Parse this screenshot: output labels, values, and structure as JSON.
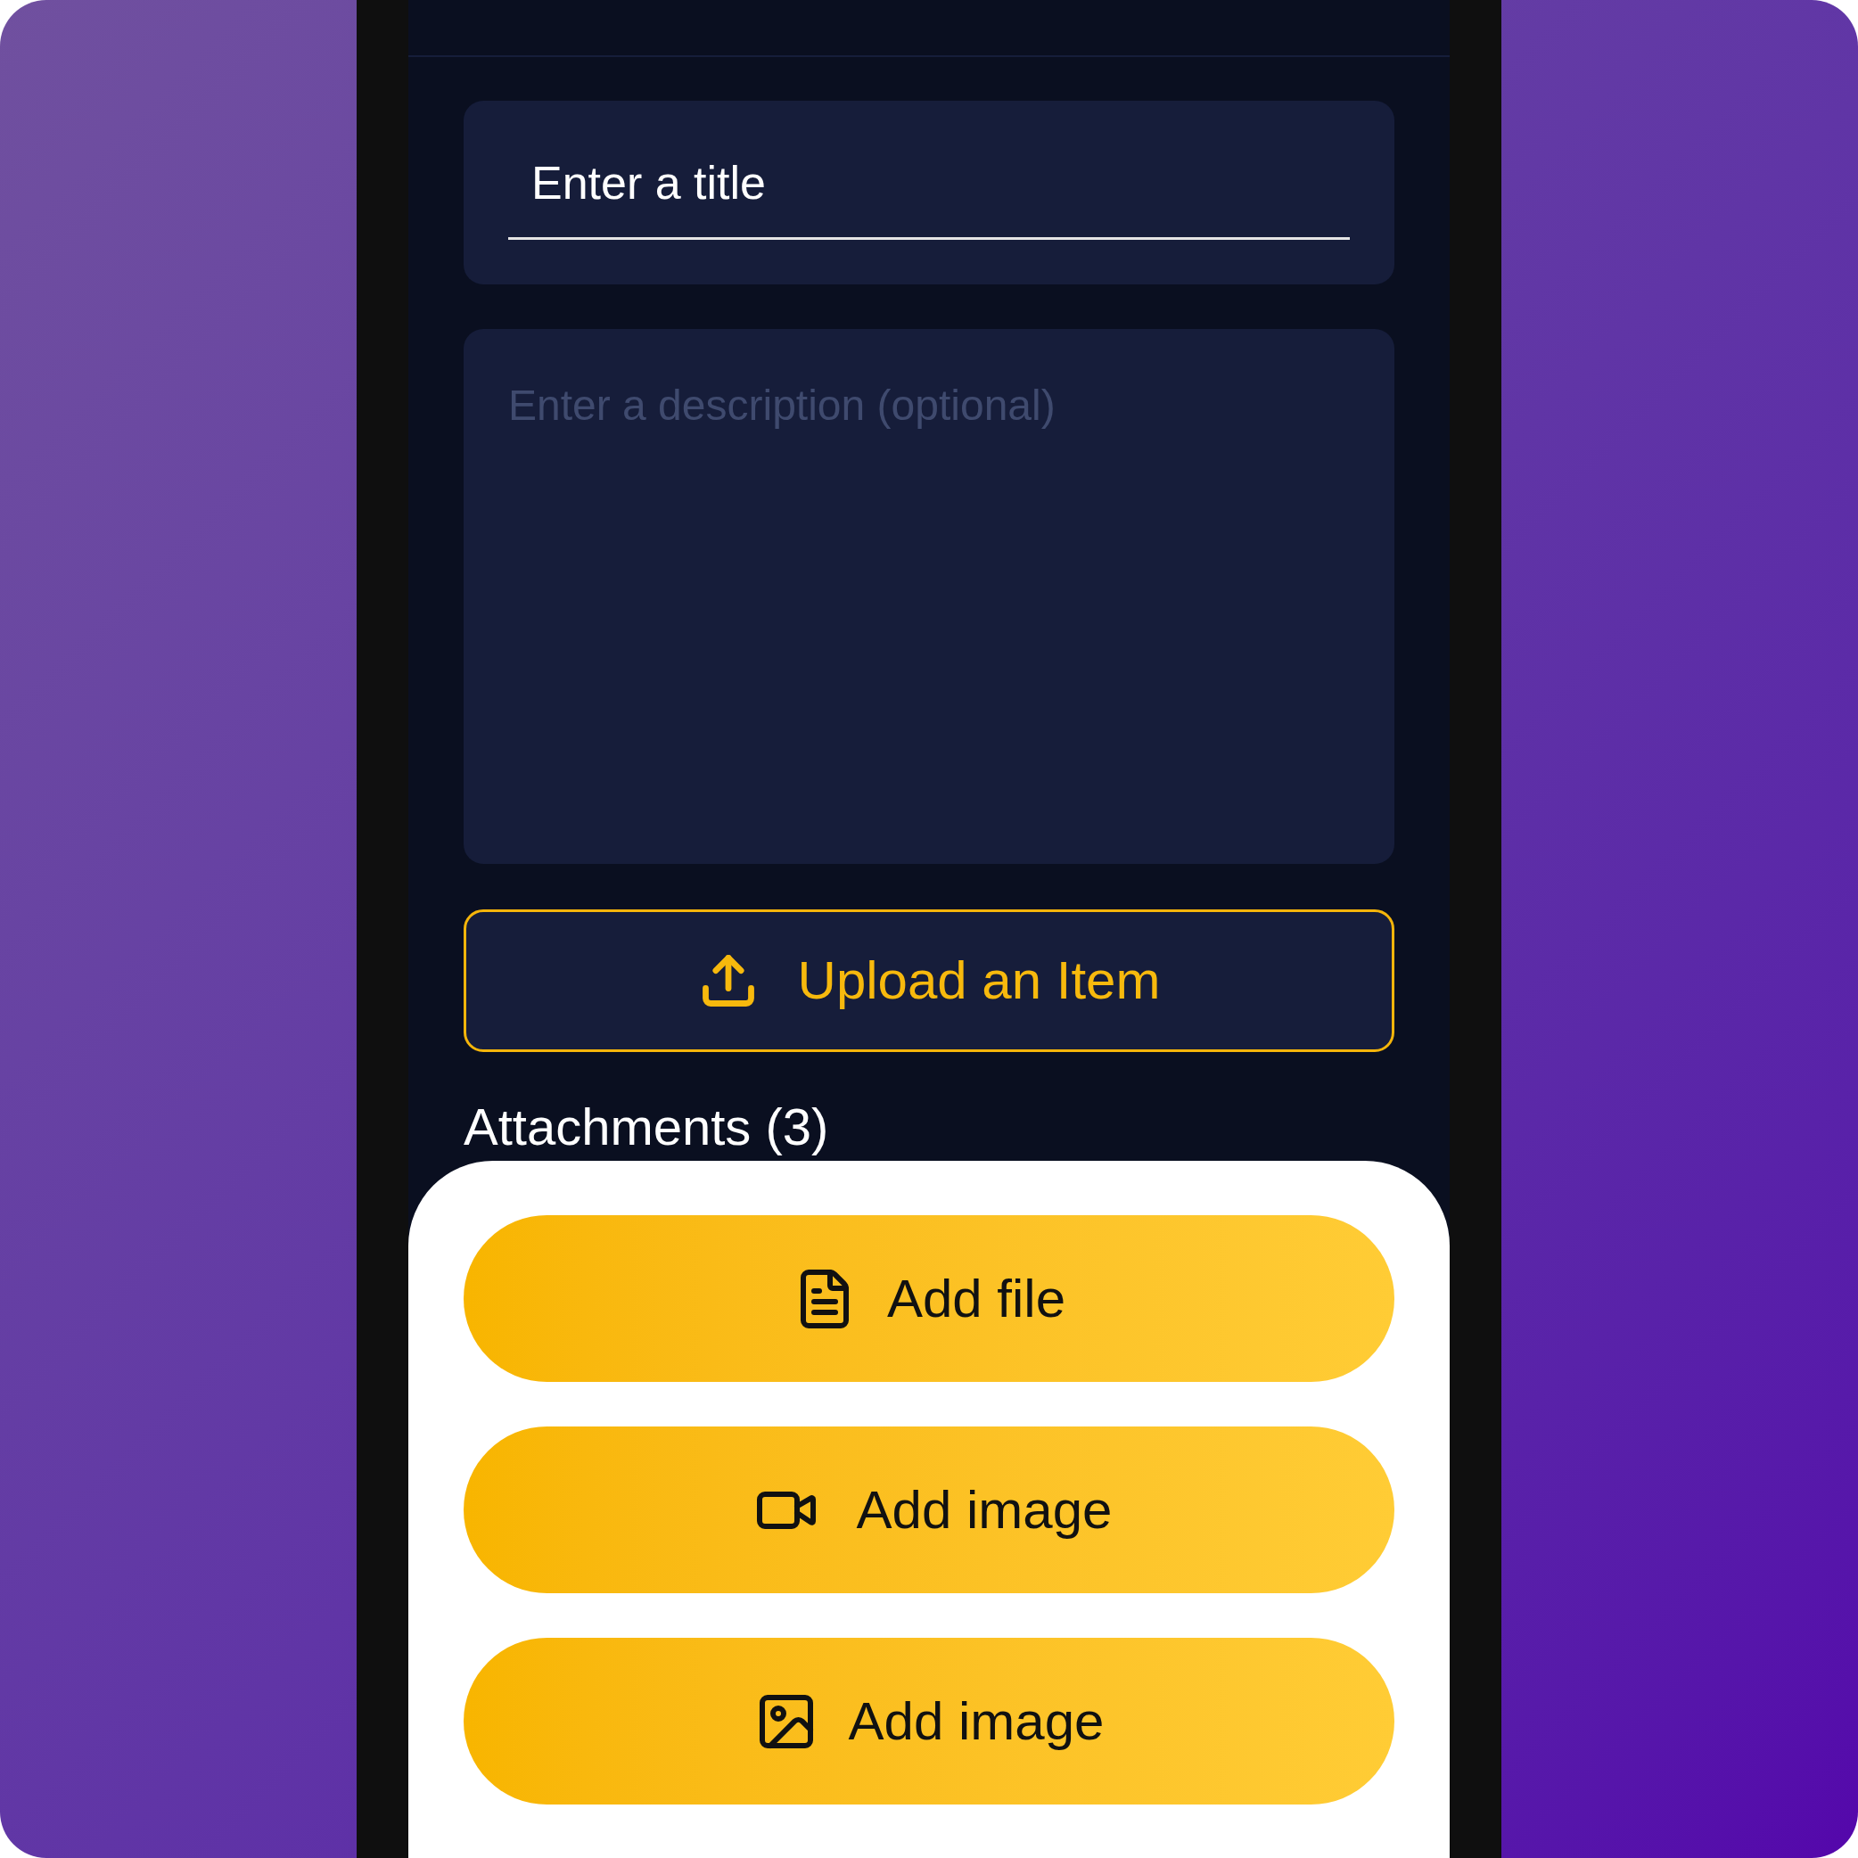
{
  "title_field": {
    "placeholder": "Enter a title"
  },
  "description_field": {
    "placeholder": "Enter a description (optional)"
  },
  "upload_button": {
    "label": "Upload an Item"
  },
  "attachments": {
    "heading": "Attachments (3)"
  },
  "sheet_buttons": [
    {
      "kind": "file",
      "label": "Add file"
    },
    {
      "kind": "video",
      "label": "Add image"
    },
    {
      "kind": "image",
      "label": "Add image"
    }
  ]
}
